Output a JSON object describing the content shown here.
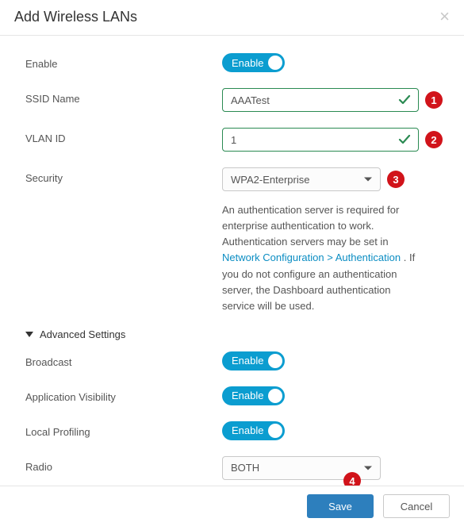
{
  "header": {
    "title": "Add Wireless LANs"
  },
  "fields": {
    "enable": {
      "label": "Enable",
      "toggle_label": "Enable"
    },
    "ssid": {
      "label": "SSID Name",
      "value": "AAATest",
      "step": "1"
    },
    "vlan": {
      "label": "VLAN ID",
      "value": "1",
      "step": "2"
    },
    "security": {
      "label": "Security",
      "value": "WPA2-Enterprise",
      "step": "3",
      "help_pre": "An authentication server is required for enterprise authentication to work. Authentication servers may be set in ",
      "help_link": "Network Configuration > Authentication",
      "help_post": " . If you do not configure an authentication server, the Dashboard authentication service will be used."
    }
  },
  "advanced": {
    "title": "Advanced Settings",
    "broadcast": {
      "label": "Broadcast",
      "toggle_label": "Enable"
    },
    "appvis": {
      "label": "Application Visibility",
      "toggle_label": "Enable"
    },
    "localprof": {
      "label": "Local Profiling",
      "toggle_label": "Enable"
    },
    "radio": {
      "label": "Radio",
      "value": "BOTH"
    }
  },
  "footer": {
    "save": "Save",
    "cancel": "Cancel",
    "step": "4"
  }
}
